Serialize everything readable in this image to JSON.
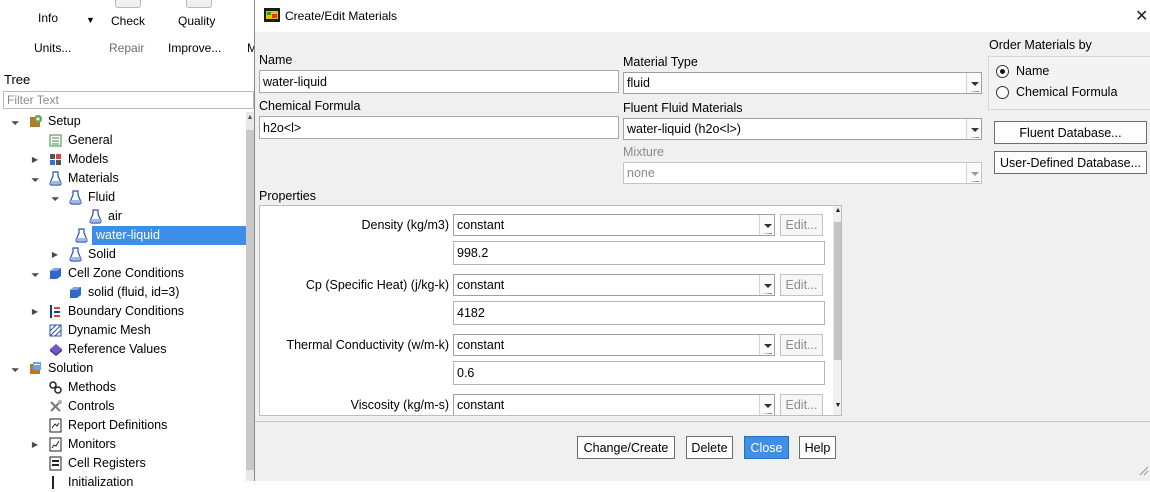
{
  "app": {
    "toolbar": {
      "row1": [
        {
          "label": "Info",
          "dim": false
        },
        {
          "label": "Check",
          "dim": false
        },
        {
          "label": "Quality",
          "dim": false
        }
      ],
      "row2": [
        {
          "label": "Units...",
          "dim": false
        },
        {
          "label": "Repair",
          "dim": true
        },
        {
          "label": "Improve...",
          "dim": false
        },
        {
          "label": "M",
          "dim": false
        }
      ]
    },
    "tree": {
      "title": "Tree",
      "filter_placeholder": "Filter Text",
      "items": [
        {
          "label": "Setup",
          "level": 0,
          "expanded": true,
          "icon": "setup-icon",
          "selected": false
        },
        {
          "label": "General",
          "level": 1,
          "expanded": null,
          "icon": "general-icon",
          "selected": false
        },
        {
          "label": "Models",
          "level": 1,
          "expanded": false,
          "icon": "models-icon",
          "selected": false
        },
        {
          "label": "Materials",
          "level": 1,
          "expanded": true,
          "icon": "flask-icon",
          "selected": false
        },
        {
          "label": "Fluid",
          "level": 2,
          "expanded": true,
          "icon": "flask-icon",
          "selected": false
        },
        {
          "label": "air",
          "level": 3,
          "expanded": null,
          "icon": "flask-icon",
          "selected": false
        },
        {
          "label": "water-liquid",
          "level": 3,
          "expanded": null,
          "icon": "flask-icon",
          "selected": true
        },
        {
          "label": "Solid",
          "level": 2,
          "expanded": false,
          "icon": "flask-icon",
          "selected": false
        },
        {
          "label": "Cell Zone Conditions",
          "level": 1,
          "expanded": true,
          "icon": "cell-zone-icon",
          "selected": false
        },
        {
          "label": "solid (fluid, id=3)",
          "level": 2,
          "expanded": null,
          "icon": "cell-zone-icon",
          "selected": false
        },
        {
          "label": "Boundary Conditions",
          "level": 1,
          "expanded": false,
          "icon": "boundary-icon",
          "selected": false
        },
        {
          "label": "Dynamic Mesh",
          "level": 1,
          "expanded": null,
          "icon": "dynamic-mesh-icon",
          "selected": false
        },
        {
          "label": "Reference Values",
          "level": 1,
          "expanded": null,
          "icon": "reference-icon",
          "selected": false
        },
        {
          "label": "Solution",
          "level": 0,
          "expanded": true,
          "icon": "solution-icon",
          "selected": false
        },
        {
          "label": "Methods",
          "level": 1,
          "expanded": null,
          "icon": "methods-icon",
          "selected": false
        },
        {
          "label": "Controls",
          "level": 1,
          "expanded": null,
          "icon": "controls-icon",
          "selected": false
        },
        {
          "label": "Report Definitions",
          "level": 1,
          "expanded": null,
          "icon": "report-icon",
          "selected": false
        },
        {
          "label": "Monitors",
          "level": 1,
          "expanded": false,
          "icon": "monitors-icon",
          "selected": false
        },
        {
          "label": "Cell Registers",
          "level": 1,
          "expanded": null,
          "icon": "registers-icon",
          "selected": false
        },
        {
          "label": "Initialization",
          "level": 1,
          "expanded": null,
          "icon": "init-icon",
          "selected": false
        }
      ]
    }
  },
  "dialog": {
    "title": "Create/Edit Materials",
    "name_label": "Name",
    "name_value": "water-liquid",
    "formula_label": "Chemical Formula",
    "formula_value": "h2o<l>",
    "material_type_label": "Material Type",
    "material_type_value": "fluid",
    "fluent_materials_label": "Fluent Fluid Materials",
    "fluent_materials_value": "water-liquid (h2o<l>)",
    "mixture_label": "Mixture",
    "mixture_value": "none",
    "order_by": {
      "title": "Order Materials by",
      "options": [
        "Name",
        "Chemical Formula"
      ],
      "selected_index": 0
    },
    "db_buttons": {
      "fluent": "Fluent Database...",
      "user": "User-Defined Database..."
    },
    "properties_title": "Properties",
    "properties": [
      {
        "label": "Density (kg/m3)",
        "method": "constant",
        "value": "998.2"
      },
      {
        "label": "Cp (Specific Heat) (j/kg-k)",
        "method": "constant",
        "value": "4182"
      },
      {
        "label": "Thermal Conductivity (w/m-k)",
        "method": "constant",
        "value": "0.6"
      },
      {
        "label": "Viscosity (kg/m-s)",
        "method": "constant",
        "value": null
      }
    ],
    "edit_label": "Edit...",
    "footer": {
      "change_create": "Change/Create",
      "delete": "Delete",
      "close": "Close",
      "help": "Help"
    },
    "colors": {
      "selection": "#3c8ee8",
      "primary_button": "#3f8fe6"
    }
  }
}
